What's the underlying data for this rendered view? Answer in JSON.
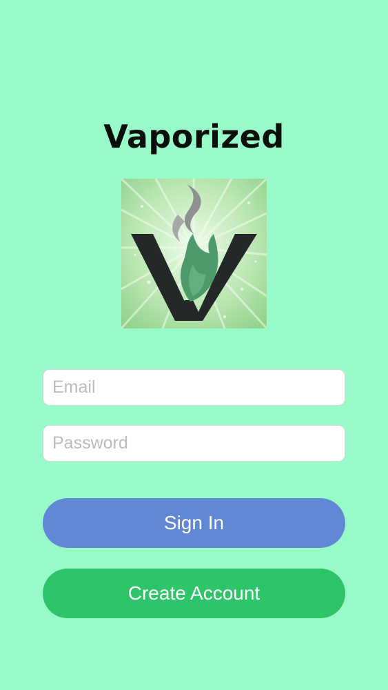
{
  "app": {
    "title": "Vaporized"
  },
  "logo": {
    "icon": "vaporized-v-flame-logo",
    "colors": {
      "background": "#9fd89a",
      "rays": "#e9f9e4",
      "letter": "#252829",
      "flame": "#4e9a6c",
      "smoke": "#9a9c9c"
    }
  },
  "form": {
    "email_placeholder": "Email",
    "password_placeholder": "Password"
  },
  "buttons": {
    "sign_in_label": "Sign In",
    "create_account_label": "Create Account"
  },
  "colors": {
    "background": "#98f9c9",
    "sign_in": "#6188d4",
    "create_account": "#2ec46a"
  }
}
